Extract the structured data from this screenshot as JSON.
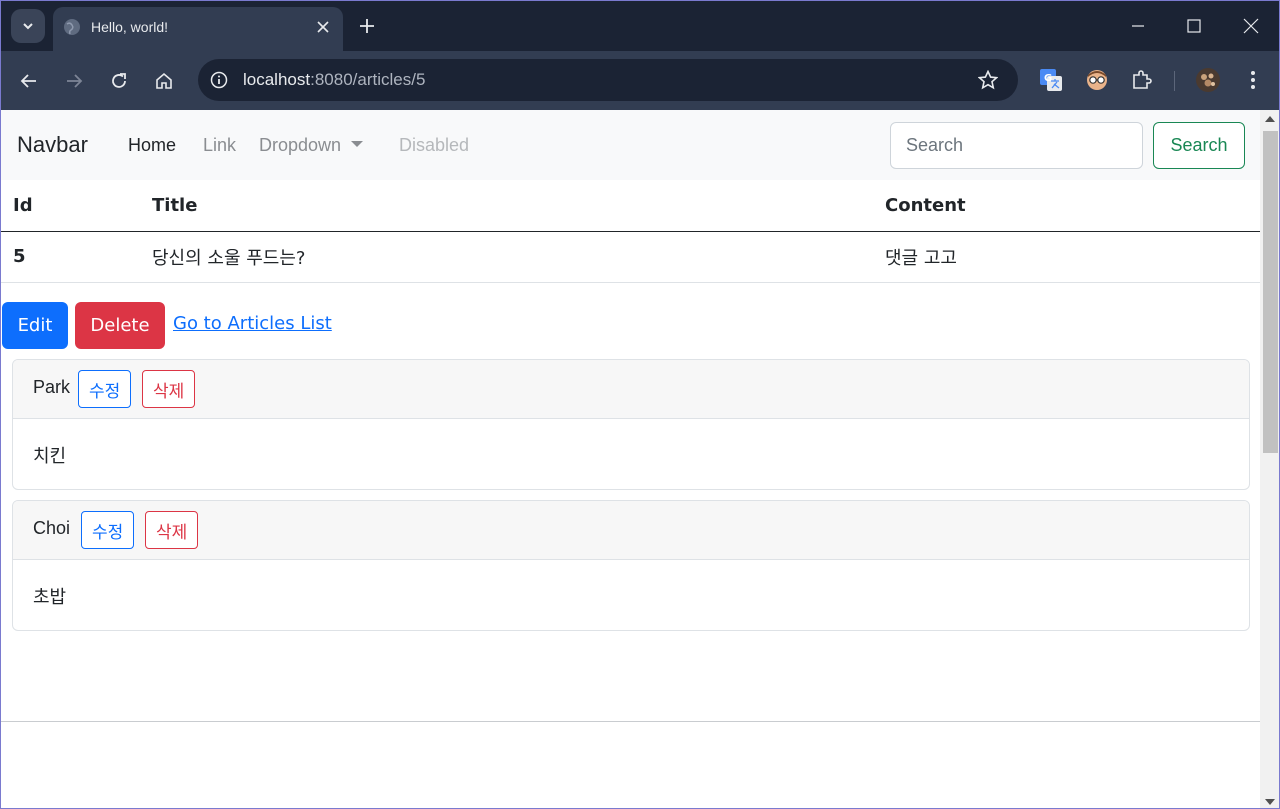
{
  "browser": {
    "tab_title": "Hello, world!",
    "url_host": "localhost",
    "url_path": ":8080/articles/5"
  },
  "navbar": {
    "brand": "Navbar",
    "links": [
      "Home",
      "Link",
      "Dropdown",
      "Disabled"
    ],
    "search_placeholder": "Search",
    "search_button": "Search"
  },
  "table": {
    "headers": [
      "Id",
      "Title",
      "Content"
    ],
    "row": {
      "id": "5",
      "title": "당신의 소울 푸드는?",
      "content": "댓글 고고"
    }
  },
  "actions": {
    "edit": "Edit",
    "delete": "Delete",
    "back_link": "Go to Articles List"
  },
  "comments": [
    {
      "nickname": "Park",
      "edit": "수정",
      "delete": "삭제",
      "body": "치킨"
    },
    {
      "nickname": "Choi",
      "edit": "수정",
      "delete": "삭제",
      "body": "초밥"
    }
  ],
  "colors": {
    "primary": "#0d6efd",
    "danger": "#dc3545",
    "success": "#198754",
    "browser_frame": "#1b2334"
  }
}
